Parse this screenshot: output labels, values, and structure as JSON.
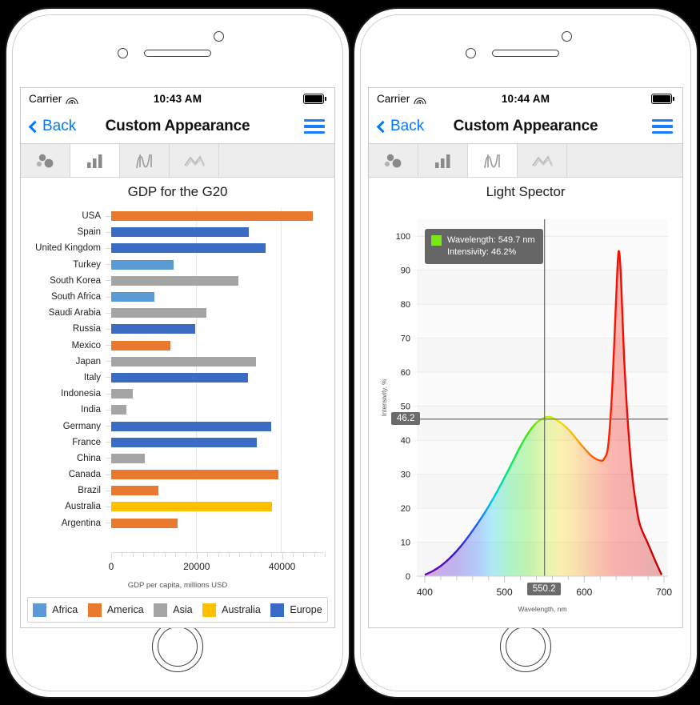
{
  "phones": [
    {
      "id": "phone-left",
      "status_bar": {
        "carrier": "Carrier",
        "time": "10:43 AM",
        "wifi_icon": "wifi-icon",
        "battery_icon": "battery-full-icon"
      },
      "nav": {
        "back_label": "Back",
        "title": "Custom Appearance",
        "menu_icon": "hamburger-menu-icon"
      },
      "tabs": [
        {
          "name": "tab-scatter",
          "icon": "bubble-chart-icon",
          "active": false
        },
        {
          "name": "tab-bar",
          "icon": "bar-chart-icon",
          "active": true
        },
        {
          "name": "tab-spline",
          "icon": "spline-chart-icon",
          "active": false
        },
        {
          "name": "tab-area",
          "icon": "area-chart-icon",
          "active": false
        }
      ],
      "chart_ref": 0
    },
    {
      "id": "phone-right",
      "status_bar": {
        "carrier": "Carrier",
        "time": "10:44 AM",
        "wifi_icon": "wifi-icon",
        "battery_icon": "battery-full-icon"
      },
      "nav": {
        "back_label": "Back",
        "title": "Custom Appearance",
        "menu_icon": "hamburger-menu-icon"
      },
      "tabs": [
        {
          "name": "tab-scatter",
          "icon": "bubble-chart-icon",
          "active": false
        },
        {
          "name": "tab-bar",
          "icon": "bar-chart-icon",
          "active": false
        },
        {
          "name": "tab-spline",
          "icon": "spline-chart-icon",
          "active": true
        },
        {
          "name": "tab-area",
          "icon": "area-chart-icon",
          "active": false
        }
      ],
      "chart_ref": 1
    }
  ],
  "chart_data": [
    {
      "type": "bar",
      "orientation": "horizontal",
      "title": "GDP for the G20",
      "xlabel": "GDP per capita, millions USD",
      "ylabel": "",
      "xlim": [
        0,
        50000
      ],
      "xticks": [
        0,
        20000,
        40000
      ],
      "xtick_labels": [
        "0",
        "20000",
        "40000"
      ],
      "grid": true,
      "legend_position": "bottom",
      "categories": [
        "USA",
        "Spain",
        "United Kingdom",
        "Turkey",
        "South Korea",
        "South Africa",
        "Saudi Arabia",
        "Russia",
        "Mexico",
        "Japan",
        "Italy",
        "Indonesia",
        "India",
        "Germany",
        "France",
        "China",
        "Canada",
        "Brazil",
        "Australia",
        "Argentina"
      ],
      "values": [
        47500,
        32400,
        36500,
        14800,
        30000,
        10100,
        22500,
        19800,
        14000,
        34200,
        32300,
        5100,
        3500,
        37700,
        34400,
        7900,
        39400,
        11200,
        37900,
        15700
      ],
      "groups": [
        "America",
        "Europe",
        "Europe",
        "Africa",
        "Asia",
        "Africa",
        "Asia",
        "Europe",
        "America",
        "Asia",
        "Europe",
        "Asia",
        "Asia",
        "Europe",
        "Europe",
        "Asia",
        "America",
        "America",
        "Australia",
        "America"
      ],
      "legend": [
        {
          "label": "Africa",
          "color": "#5B9BD5"
        },
        {
          "label": "America",
          "color": "#E8792E"
        },
        {
          "label": "Asia",
          "color": "#A5A5A5"
        },
        {
          "label": "Australia",
          "color": "#FFC000"
        },
        {
          "label": "Europe",
          "color": "#3B6CC4"
        }
      ]
    },
    {
      "type": "area",
      "title": "Light Spector",
      "xlabel": "Wavelength, nm",
      "ylabel": "Intensivity, %",
      "xlim": [
        390,
        705
      ],
      "ylim": [
        0,
        105
      ],
      "xticks": [
        400,
        500,
        600,
        700
      ],
      "xtick_labels": [
        "400",
        "500",
        "600",
        "700"
      ],
      "yticks": [
        0,
        10,
        20,
        30,
        40,
        50,
        60,
        70,
        80,
        90,
        100
      ],
      "ytick_labels": [
        "0",
        "10",
        "20",
        "30",
        "40",
        "50",
        "60",
        "70",
        "80",
        "90",
        "100"
      ],
      "grid": true,
      "tooltip": {
        "line1": "Wavelength: 549.7 nm",
        "line2": "Intensivity: 46.2%",
        "swatch_color": "#7CE813"
      },
      "crosshair": {
        "x_label": "550.2",
        "y_label": "46.2",
        "x_value": 550.2,
        "y_value": 46.2
      },
      "x": [
        400,
        410,
        420,
        430,
        440,
        450,
        460,
        470,
        480,
        490,
        500,
        510,
        520,
        530,
        540,
        550,
        555,
        560,
        570,
        580,
        590,
        600,
        610,
        620,
        625,
        630,
        635,
        640,
        643,
        646,
        650,
        655,
        660,
        665,
        670,
        680,
        690,
        697
      ],
      "y": [
        0.4,
        1.5,
        3.0,
        5.0,
        7.4,
        10.2,
        13.4,
        16.8,
        20.5,
        24.6,
        29.0,
        33.6,
        38.2,
        42.2,
        45.1,
        46.6,
        46.9,
        46.6,
        45.2,
        43.2,
        40.4,
        37.6,
        35.2,
        34.0,
        34.6,
        38.5,
        55.0,
        82.0,
        95.5,
        88.0,
        64.0,
        44.0,
        30.0,
        21.0,
        15.0,
        9.5,
        4.0,
        0.4
      ]
    }
  ]
}
